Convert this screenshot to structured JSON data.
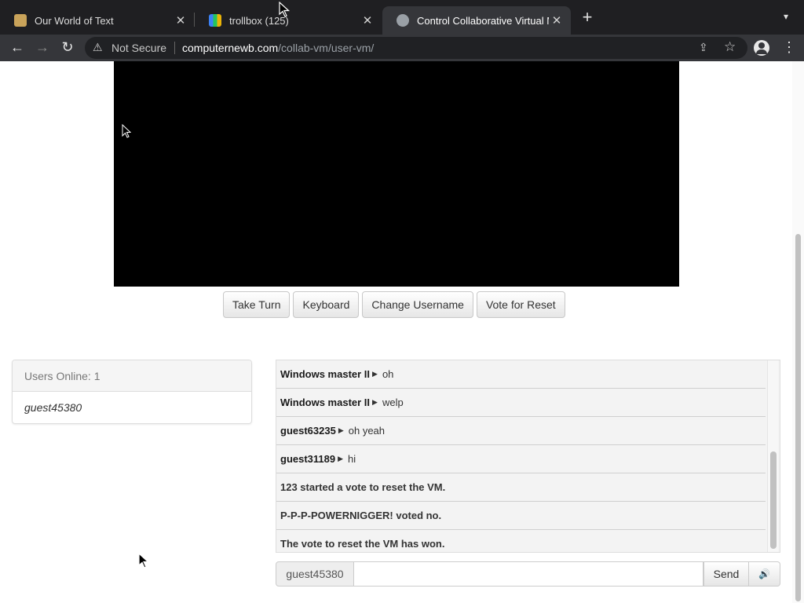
{
  "browser": {
    "tabs": [
      {
        "title": "Our World of Text",
        "active": false
      },
      {
        "title": "trollbox (125)",
        "active": false
      },
      {
        "title": "Control Collaborative Virtual M",
        "active": true
      }
    ],
    "security_label": "Not Secure",
    "url_host": "computernewb.com",
    "url_path": "/collab-vm/user-vm/"
  },
  "vm": {
    "buttons": [
      "Take Turn",
      "Keyboard",
      "Change Username",
      "Vote for Reset"
    ]
  },
  "users": {
    "header": "Users Online: 1",
    "list": [
      "guest45380"
    ]
  },
  "chat": {
    "messages": [
      {
        "user": "Windows master II",
        "text": "oh"
      },
      {
        "user": "Windows master II",
        "text": "welp"
      },
      {
        "user": "guest63235",
        "text": "oh yeah"
      },
      {
        "user": "guest31189",
        "text": "hi"
      },
      {
        "user": "",
        "text": "123 started a vote to reset the VM."
      },
      {
        "user": "",
        "text": "P-P-P-POWERNIGGER! voted no."
      },
      {
        "user": "",
        "text": "The vote to reset the VM has won."
      }
    ],
    "username": "guest45380",
    "input_value": "",
    "send_label": "Send"
  },
  "icons": {
    "tab1_favicon": "owot-icon",
    "tab2_favicon": "trollbox-icon",
    "tab3_favicon": "collabvm-icon"
  }
}
